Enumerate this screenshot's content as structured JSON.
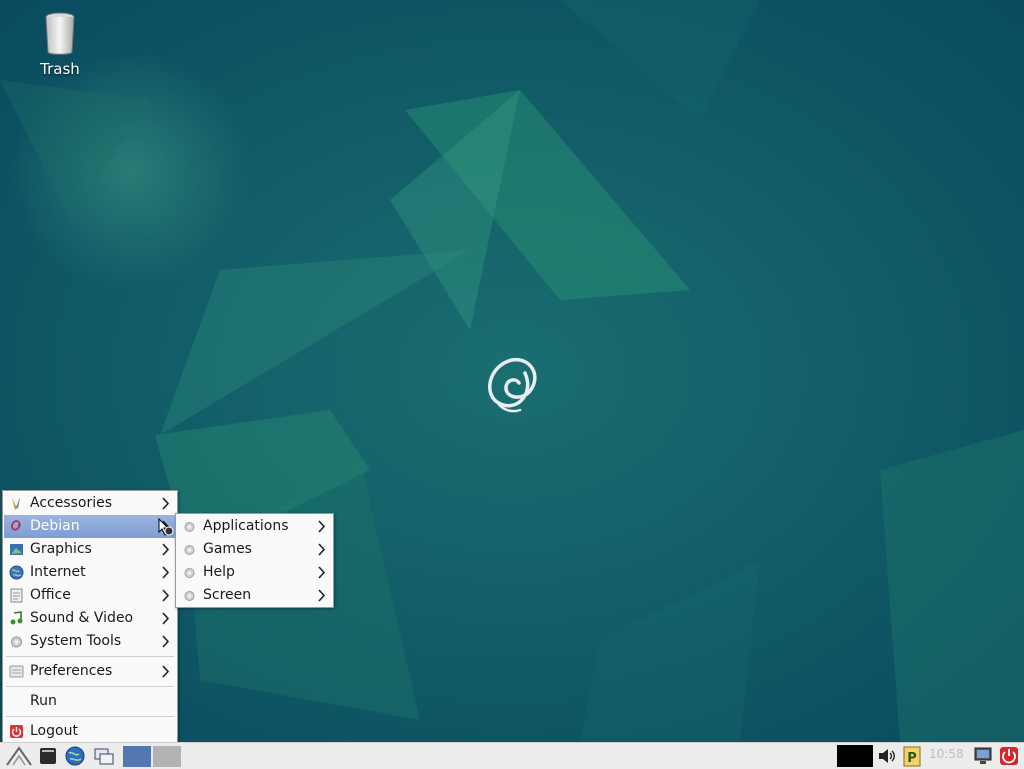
{
  "desktop": {
    "icons": [
      {
        "label": "Trash",
        "icon": "trash-icon"
      }
    ]
  },
  "start_menu": {
    "items": [
      {
        "label": "Accessories",
        "icon": "accessories-icon",
        "submenu": true
      },
      {
        "label": "Debian",
        "icon": "debian-icon",
        "submenu": true,
        "highlighted": true
      },
      {
        "label": "Graphics",
        "icon": "graphics-icon",
        "submenu": true
      },
      {
        "label": "Internet",
        "icon": "internet-icon",
        "submenu": true
      },
      {
        "label": "Office",
        "icon": "office-icon",
        "submenu": true
      },
      {
        "label": "Sound & Video",
        "icon": "sound-video-icon",
        "submenu": true
      },
      {
        "label": "System Tools",
        "icon": "system-tools-icon",
        "submenu": true
      },
      {
        "label": "Preferences",
        "icon": "preferences-icon",
        "submenu": true
      },
      {
        "label": "Run"
      },
      {
        "label": "Logout",
        "icon": "logout-icon"
      }
    ]
  },
  "debian_submenu": {
    "items": [
      {
        "label": "Applications",
        "icon": "gear-icon",
        "submenu": true
      },
      {
        "label": "Games",
        "icon": "gear-icon",
        "submenu": true
      },
      {
        "label": "Help",
        "icon": "gear-icon",
        "submenu": true
      },
      {
        "label": "Screen",
        "icon": "gear-icon",
        "submenu": true
      }
    ]
  },
  "taskbar": {
    "launchers": [
      "menu-launcher-icon",
      "terminal-icon",
      "web-browser-icon",
      "show-desktop-icon"
    ],
    "tray": [
      "cpu-monitor",
      "volume-icon",
      "clipboard-icon",
      "network-icon",
      "shutdown-icon"
    ],
    "clock": "10:58"
  },
  "colors": {
    "wallpaper": "#0d5a6a",
    "menu_bg": "#fafafa",
    "highlight": "#8aa8da",
    "taskbar": "#ececec"
  }
}
